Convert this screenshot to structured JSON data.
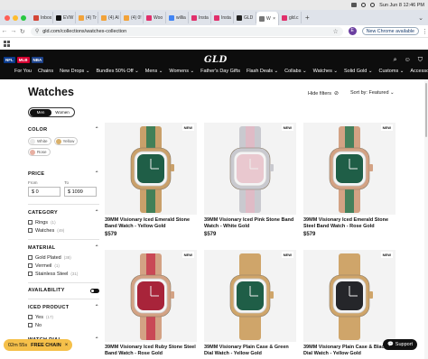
{
  "menubar": {
    "datetime": "Sun Jun 8  12:46 PM"
  },
  "tabs": [
    {
      "label": "Inbox",
      "color": "#d44638"
    },
    {
      "label": "EVW",
      "color": "#111111"
    },
    {
      "label": "(4) Tr",
      "color": "#f2a33a"
    },
    {
      "label": "(4) Al",
      "color": "#f2a33a"
    },
    {
      "label": "(4) 0!",
      "color": "#f2a33a"
    },
    {
      "label": "Woo",
      "color": "#e1306c"
    },
    {
      "label": "willia",
      "color": "#4285f4"
    },
    {
      "label": "Insta",
      "color": "#e1306c"
    },
    {
      "label": "Insta",
      "color": "#e1306c"
    },
    {
      "label": "GLD",
      "color": "#222222"
    },
    {
      "label": "W",
      "color": "#777777"
    },
    {
      "label": "gld.c",
      "color": "#e1306c"
    }
  ],
  "active_tab_index": 10,
  "address": {
    "url": "gld.com/collections/watches-collection",
    "new_chrome": "New Chrome available"
  },
  "site": {
    "logo": "GLD",
    "nav": [
      "For You",
      "Chains",
      "New Drops",
      "Bundles 50% Off",
      "Mens",
      "Womens",
      "Father's Day Gifts",
      "Flash Deals",
      "Collabs",
      "Watches",
      "Solid Gold",
      "Customs",
      "Accessories"
    ],
    "nav_has_dropdown": [
      false,
      false,
      true,
      true,
      true,
      true,
      false,
      true,
      true,
      true,
      true,
      true,
      true
    ]
  },
  "page": {
    "title": "Watches",
    "hide_filters": "Hide filters",
    "sort_by": "Sort by:",
    "sort_value": "Featured"
  },
  "sidebar": {
    "gender": [
      "Men",
      "Women"
    ],
    "color_title": "COLOR",
    "colors": [
      {
        "label": "White",
        "hex": "#e8e8e8"
      },
      {
        "label": "Yellow",
        "hex": "#d9b06a"
      },
      {
        "label": "Rose",
        "hex": "#e7b0a3"
      }
    ],
    "price_title": "PRICE",
    "price_from_label": "From",
    "price_to_label": "To",
    "price_from": "$  0",
    "price_to": "$  1099",
    "category_title": "CATEGORY",
    "categories": [
      {
        "label": "Rings",
        "count": "(1)"
      },
      {
        "label": "Watches",
        "count": "(49)"
      }
    ],
    "material_title": "MATERIAL",
    "materials": [
      {
        "label": "Gold Plated",
        "count": "(38)"
      },
      {
        "label": "Vermeil",
        "count": "(1)"
      },
      {
        "label": "Stainless Steel",
        "count": "(31)"
      }
    ],
    "availability_title": "AVAILABILITY",
    "iced_title": "ICED PRODUCT",
    "iced": [
      {
        "label": "Yes",
        "count": "(17)"
      },
      {
        "label": "No",
        "count": ""
      }
    ],
    "watch_dial_title": "WATCH DIAL"
  },
  "products": [
    {
      "name": "39MM Visionary Iced Emerald Stone Band Watch - Yellow Gold",
      "price": "$579",
      "badge": "NEW",
      "case": "#c9a06a",
      "dial": "#1f5e47",
      "band_accent": "#2a7a55"
    },
    {
      "name": "39MM Visionary Iced Pink Stone Band Watch - White Gold",
      "price": "$579",
      "badge": "NEW",
      "case": "#c9c9cf",
      "dial": "#e9c8cf",
      "band_accent": "#e3b8c4"
    },
    {
      "name": "39MM Visionary Iced Emerald Stone Steel Band Watch - Rose Gold",
      "price": "$579",
      "badge": "NEW",
      "case": "#d3a284",
      "dial": "#1f5e47",
      "band_accent": "#2a7a55"
    },
    {
      "name": "39MM Visionary Iced Ruby Stone Steel Band Watch - Rose Gold",
      "price": "",
      "badge": "NEW",
      "case": "#d3a284",
      "dial": "#a8243a",
      "band_accent": "#c73a4e"
    },
    {
      "name": "39MM Visionary Plain Case & Green Dial Watch - Yellow Gold",
      "price": "",
      "badge": "NEW",
      "case": "#cfa56a",
      "dial": "#1f5e47",
      "band_accent": "#cfa56a"
    },
    {
      "name": "39MM Visionary Plain Case & Black Dial Watch - Yellow Gold",
      "price": "",
      "badge": "NEW",
      "case": "#cfa56a",
      "dial": "#25262a",
      "band_accent": "#cfa56a"
    }
  ],
  "promo": {
    "timer": "02m 55s",
    "label": "FREE CHAIN"
  },
  "support": {
    "label": "Support"
  }
}
